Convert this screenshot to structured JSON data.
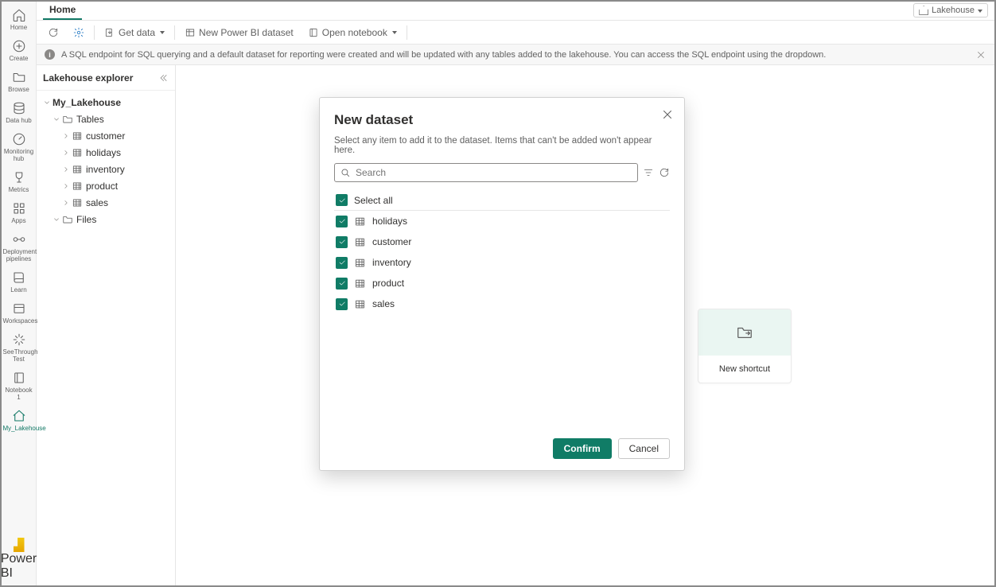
{
  "rail": {
    "items": [
      {
        "label": "Home"
      },
      {
        "label": "Create"
      },
      {
        "label": "Browse"
      },
      {
        "label": "Data hub"
      },
      {
        "label": "Monitoring hub"
      },
      {
        "label": "Metrics"
      },
      {
        "label": "Apps"
      },
      {
        "label": "Deployment pipelines"
      },
      {
        "label": "Learn"
      },
      {
        "label": "Workspaces"
      },
      {
        "label": "SeeThrough Test"
      },
      {
        "label": "Notebook 1"
      },
      {
        "label": "My_Lakehouse"
      }
    ],
    "bottom_label": "Power BI"
  },
  "top": {
    "tab": "Home",
    "mode": "Lakehouse"
  },
  "toolbar": {
    "get_data": "Get data",
    "new_dataset": "New Power BI dataset",
    "open_notebook": "Open notebook"
  },
  "banner": {
    "text": "A SQL endpoint for SQL querying and a default dataset for reporting were created and will be updated with any tables added to the lakehouse. You can access the SQL endpoint using the dropdown."
  },
  "explorer": {
    "title": "Lakehouse explorer",
    "root": "My_Lakehouse",
    "tables_label": "Tables",
    "tables": [
      "customer",
      "holidays",
      "inventory",
      "product",
      "sales"
    ],
    "files_label": "Files"
  },
  "card": {
    "label": "New shortcut"
  },
  "modal": {
    "title": "New dataset",
    "subtitle": "Select any item to add it to the dataset. Items that can't be added won't appear here.",
    "search_placeholder": "Search",
    "select_all": "Select all",
    "items": [
      "holidays",
      "customer",
      "inventory",
      "product",
      "sales"
    ],
    "confirm": "Confirm",
    "cancel": "Cancel"
  }
}
